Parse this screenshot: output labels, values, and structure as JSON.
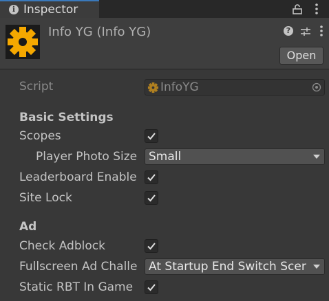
{
  "tab": {
    "title": "Inspector",
    "icon": "info-icon"
  },
  "header": {
    "title": "Info YG (Info YG)",
    "icon": "gear-icon",
    "open_label": "Open"
  },
  "script": {
    "label": "Script",
    "value": "InfoYG"
  },
  "sections": {
    "basic": "Basic Settings",
    "ad": "Ad"
  },
  "fields": {
    "scopes": {
      "label": "Scopes",
      "checked": true
    },
    "player_photo_size": {
      "label": "Player Photo Size",
      "value": "Small"
    },
    "leaderboard": {
      "label": "Leaderboard Enable",
      "checked": true
    },
    "site_lock": {
      "label": "Site Lock",
      "checked": true
    },
    "check_adblock": {
      "label": "Check Adblock",
      "checked": true
    },
    "fullscreen_ad": {
      "label": "Fullscreen Ad Challe",
      "value": "At Startup End Switch Scer"
    },
    "static_rbt": {
      "label": "Static RBT In Game",
      "checked": true
    }
  },
  "colors": {
    "background": "#383838",
    "header": "#3e3e3e",
    "tabbar": "#282828",
    "accent": "#3a79bb",
    "gear": "#f5a800"
  }
}
